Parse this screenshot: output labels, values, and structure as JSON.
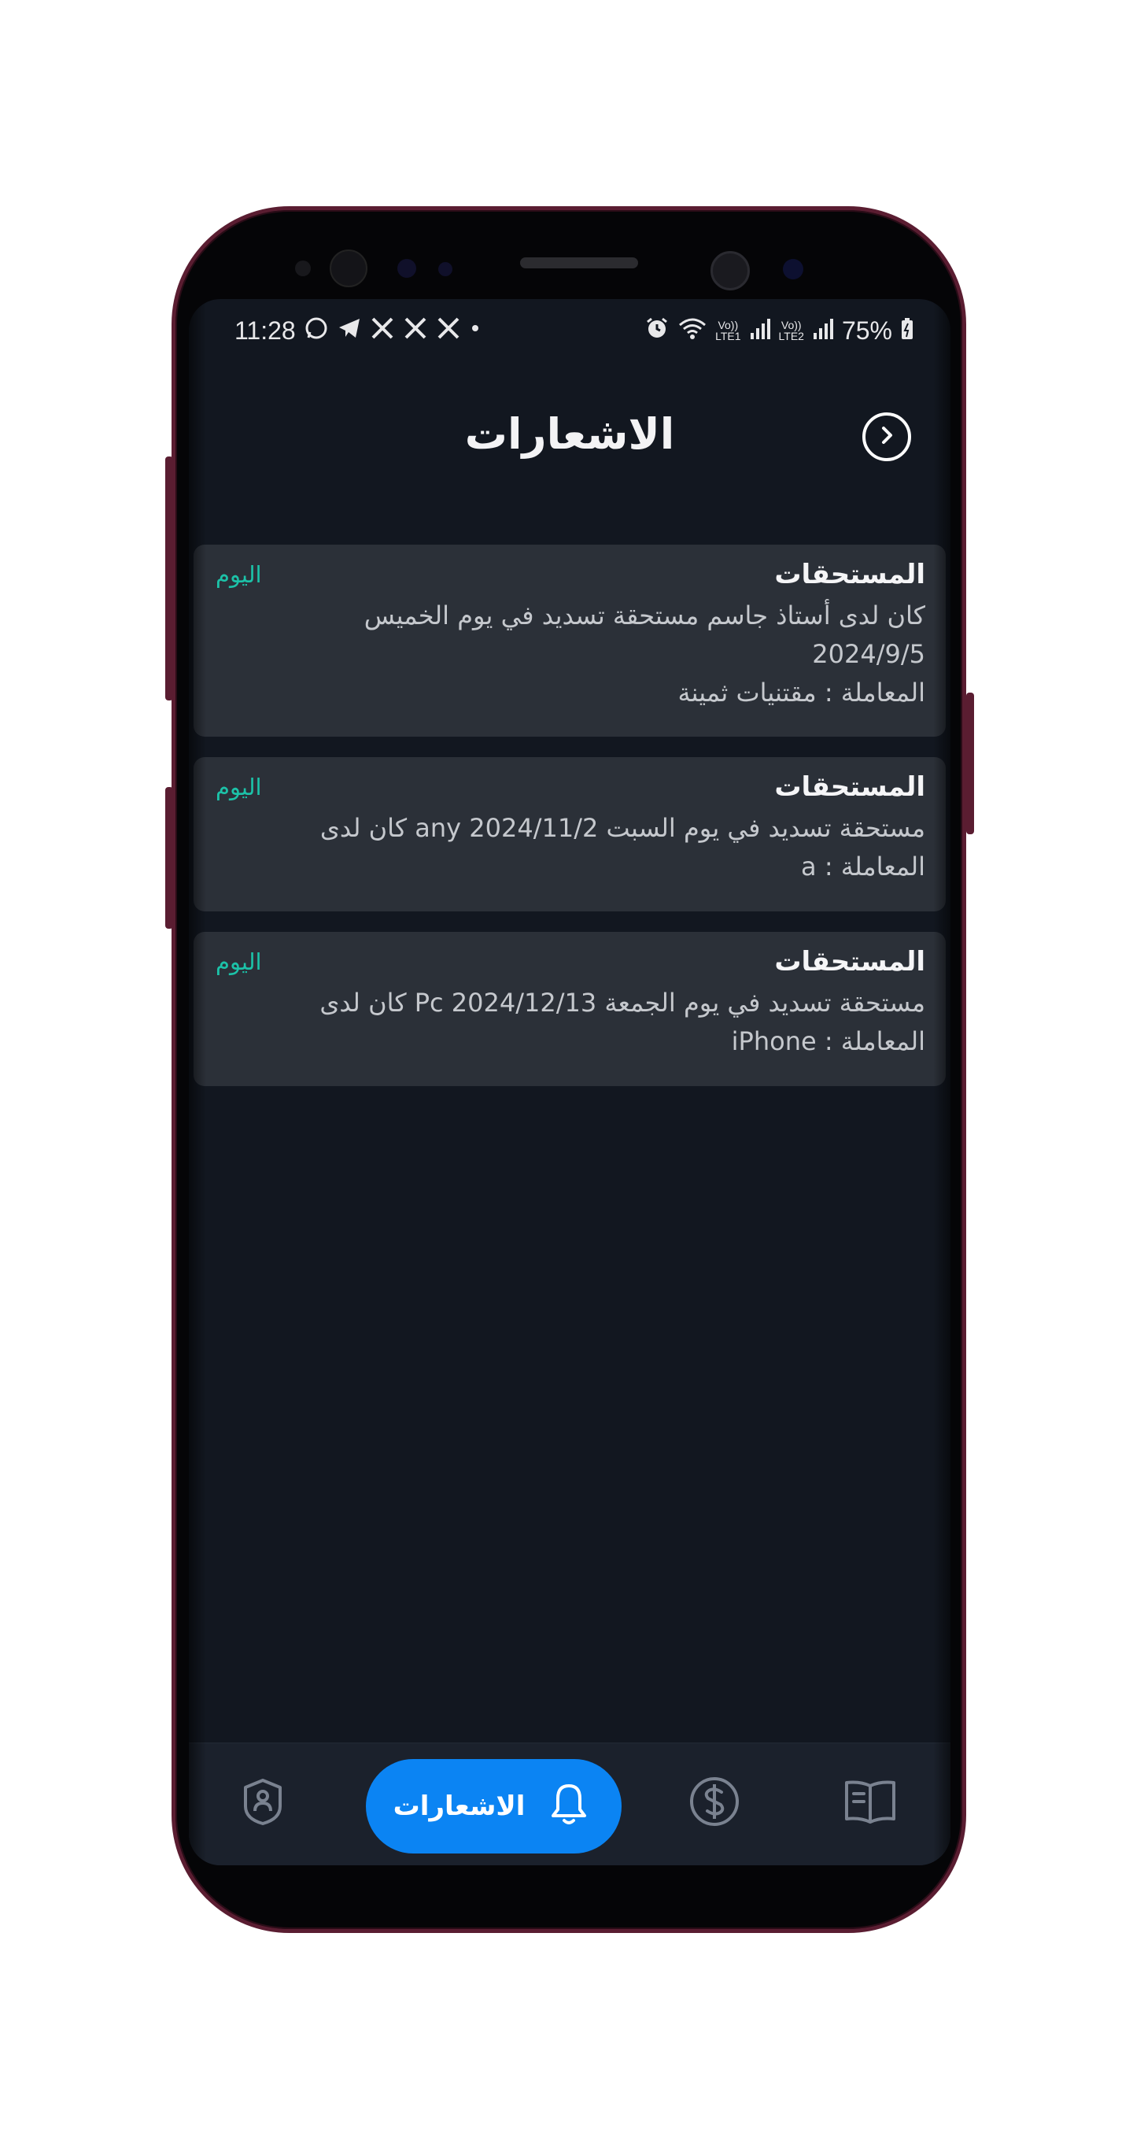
{
  "status_bar": {
    "time": "11:28",
    "battery": "75%",
    "left_icons": [
      "whatsapp-icon",
      "telegram-icon",
      "x-icon",
      "x-icon",
      "x-icon",
      "dot-icon"
    ],
    "right_icons": [
      "alarm-icon",
      "wifi-icon",
      "volte1-signal-icon",
      "volte2-signal-icon",
      "battery-icon"
    ],
    "sim1_label_top": "Vo))",
    "sim1_label_bottom": "LTE1",
    "sim2_label_top": "Vo))",
    "sim2_label_bottom": "LTE2"
  },
  "header": {
    "title": "الاشعارات",
    "back_icon": "chevron-right-circle-icon"
  },
  "notifications": [
    {
      "title": "المستحقات",
      "date": "اليوم",
      "lines": [
        "كان لدى أستاذ جاسم مستحقة تسديد في يوم الخميس",
        "2024/9/5",
        "المعاملة : مقتنيات ثمينة"
      ]
    },
    {
      "title": "المستحقات",
      "date": "اليوم",
      "lines": [
        "مستحقة تسديد في يوم السبت 2024/11/2 any كان لدى",
        "المعاملة : a"
      ]
    },
    {
      "title": "المستحقات",
      "date": "اليوم",
      "lines": [
        "مستحقة تسديد في يوم الجمعة 2024/12/13 Pc كان لدى",
        "المعاملة : iPhone"
      ]
    }
  ],
  "bottom_nav": {
    "active_label": "الاشعارات",
    "items": [
      "book-icon",
      "dollar-icon",
      "bell-icon",
      "profile-shield-icon"
    ],
    "colors": {
      "active_bg": "#0b84f3",
      "inactive_icon": "#7a8290",
      "accent_date": "#1cc2a8",
      "background": "#121720",
      "card": "#2b3038"
    }
  }
}
